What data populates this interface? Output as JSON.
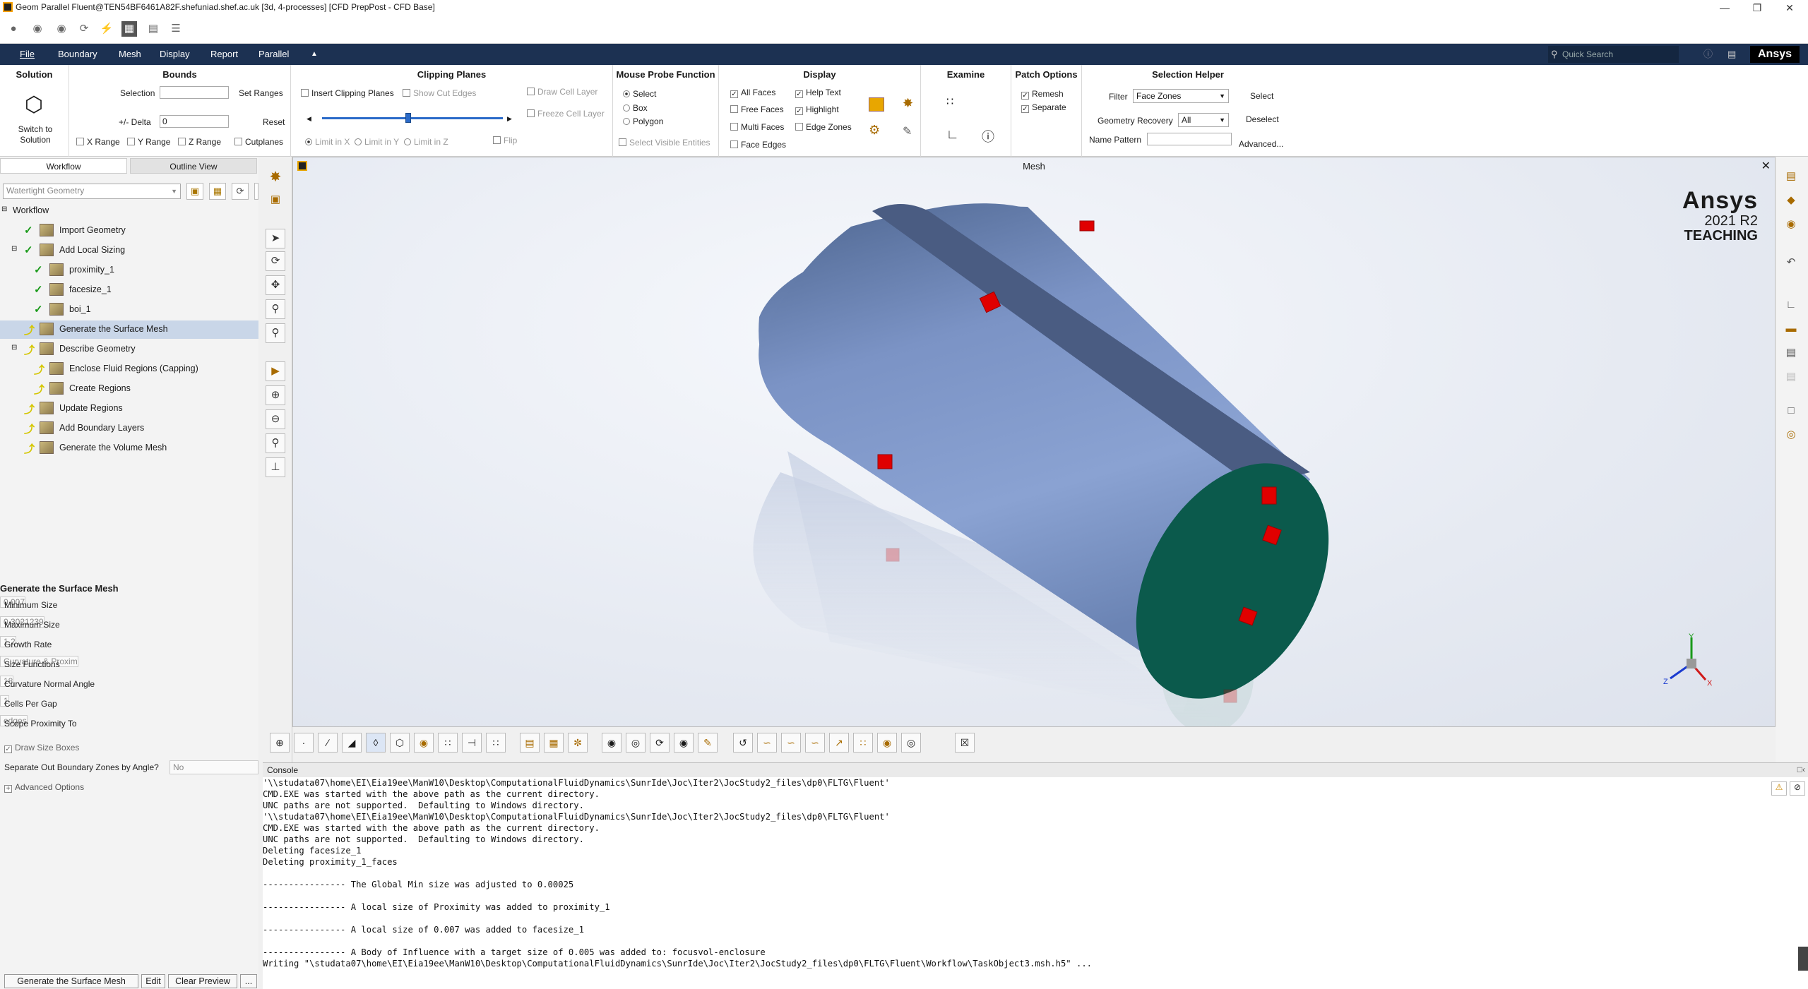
{
  "window": {
    "title": "Geom Parallel Fluent@TEN54BF6461A82F.shefuniad.shef.ac.uk  [3d, 4-processes] [CFD PrepPost - CFD Base]"
  },
  "menubar": {
    "items": [
      "File",
      "Boundary",
      "Mesh",
      "Display",
      "Report",
      "Parallel"
    ],
    "search_placeholder": "Quick Search",
    "brand": "Ansys"
  },
  "ribbon": {
    "solution": {
      "title": "Solution",
      "switch_label": "Switch to\nSolution"
    },
    "bounds": {
      "title": "Bounds",
      "selection_label": "Selection",
      "set_ranges": "Set Ranges",
      "delta_label": "+/- Delta",
      "delta_value": "0",
      "reset": "Reset",
      "x_range": "X Range",
      "y_range": "Y Range",
      "z_range": "Z Range",
      "cutplanes": "Cutplanes"
    },
    "clipping": {
      "title": "Clipping Planes",
      "insert": "Insert Clipping Planes",
      "show_cut": "Show Cut Edges",
      "draw_cell": "Draw Cell Layer",
      "freeze_cell": "Freeze Cell Layer",
      "limit_x": "Limit in X",
      "limit_y": "Limit in Y",
      "limit_z": "Limit in Z",
      "flip": "Flip"
    },
    "probe": {
      "title": "Mouse Probe Function",
      "select": "Select",
      "box": "Box",
      "polygon": "Polygon",
      "visible": "Select Visible Entities"
    },
    "display": {
      "title": "Display",
      "all_faces": "All Faces",
      "free_faces": "Free Faces",
      "multi_faces": "Multi Faces",
      "face_edges": "Face Edges",
      "help_text": "Help Text",
      "highlight": "Highlight",
      "edge_zones": "Edge Zones"
    },
    "examine": {
      "title": "Examine"
    },
    "patch": {
      "title": "Patch Options",
      "remesh": "Remesh",
      "separate": "Separate"
    },
    "helper": {
      "title": "Selection Helper",
      "filter_label": "Filter",
      "filter_value": "Face Zones",
      "select": "Select",
      "geom_label": "Geometry Recovery",
      "geom_value": "All",
      "deselect": "Deselect",
      "name_label": "Name Pattern",
      "advanced": "Advanced..."
    }
  },
  "left": {
    "tabs": [
      "Workflow",
      "Outline View"
    ],
    "workflow_type": "Watertight Geometry",
    "tree": [
      {
        "label": "Workflow",
        "state": "root",
        "indent": 0
      },
      {
        "label": "Import Geometry",
        "state": "done",
        "indent": 1
      },
      {
        "label": "Add Local Sizing",
        "state": "done",
        "indent": 1
      },
      {
        "label": "proximity_1",
        "state": "done",
        "indent": 2
      },
      {
        "label": "facesize_1",
        "state": "done",
        "indent": 2
      },
      {
        "label": "boi_1",
        "state": "done",
        "indent": 2
      },
      {
        "label": "Generate the Surface Mesh",
        "state": "active",
        "indent": 1
      },
      {
        "label": "Describe Geometry",
        "state": "pending",
        "indent": 1
      },
      {
        "label": "Enclose Fluid Regions (Capping)",
        "state": "pending",
        "indent": 2
      },
      {
        "label": "Create Regions",
        "state": "pending",
        "indent": 2
      },
      {
        "label": "Update Regions",
        "state": "pending",
        "indent": 1
      },
      {
        "label": "Add Boundary Layers",
        "state": "pending",
        "indent": 1
      },
      {
        "label": "Generate the Volume Mesh",
        "state": "pending",
        "indent": 1
      }
    ],
    "props_title": "Generate the Surface Mesh",
    "props": [
      {
        "label": "Minimum Size",
        "value": "0.007"
      },
      {
        "label": "Maximum Size",
        "value": "0.3021239"
      },
      {
        "label": "Growth Rate",
        "value": "1.2"
      },
      {
        "label": "Size Functions",
        "value": "Curvature & Proxim"
      },
      {
        "label": "Curvature Normal Angle",
        "value": "18"
      },
      {
        "label": "Cells Per Gap",
        "value": "1"
      },
      {
        "label": "Scope Proximity To",
        "value": "edges"
      }
    ],
    "draw_size_boxes": "Draw Size Boxes",
    "separate_label": "Separate Out Boundary Zones by Angle?",
    "separate_value": "No",
    "advanced": "Advanced Options",
    "buttons": {
      "generate": "Generate the Surface Mesh",
      "edit": "Edit",
      "clear": "Clear Preview",
      "more": "..."
    }
  },
  "viewport": {
    "title": "Mesh",
    "watermark": {
      "brand": "Ansys",
      "version": "2021 R2",
      "edition": "TEACHING"
    },
    "colors": {
      "cylinder": "#7f9acc",
      "cap": "#0b5a4c",
      "marker": "#e00000"
    }
  },
  "console": {
    "title": "Console",
    "lines": [
      "'\\\\studata07\\home\\EI\\Eia19ee\\ManW10\\Desktop\\ComputationalFluidDynamics\\SunrIde\\Joc\\Iter2\\JocStudy2_files\\dp0\\FLTG\\Fluent'",
      "CMD.EXE was started with the above path as the current directory.",
      "UNC paths are not supported.  Defaulting to Windows directory.",
      "'\\\\studata07\\home\\EI\\Eia19ee\\ManW10\\Desktop\\ComputationalFluidDynamics\\SunrIde\\Joc\\Iter2\\JocStudy2_files\\dp0\\FLTG\\Fluent'",
      "CMD.EXE was started with the above path as the current directory.",
      "UNC paths are not supported.  Defaulting to Windows directory.",
      "Deleting facesize_1",
      "Deleting proximity_1_faces",
      "",
      "---------------- The Global Min size was adjusted to 0.00025",
      "",
      "---------------- A local size of Proximity was added to proximity_1",
      "",
      "---------------- A local size of 0.007 was added to facesize_1",
      "",
      "---------------- A Body of Influence with a target size of 0.005 was added to: focusvol-enclosure",
      "Writing \"\\studata07\\home\\EI\\Eia19ee\\ManW10\\Desktop\\ComputationalFluidDynamics\\SunrIde\\Joc\\Iter2\\JocStudy2_files\\dp0\\FLTG\\Fluent\\Workflow\\TaskObject3.msh.h5\" ..."
    ]
  }
}
